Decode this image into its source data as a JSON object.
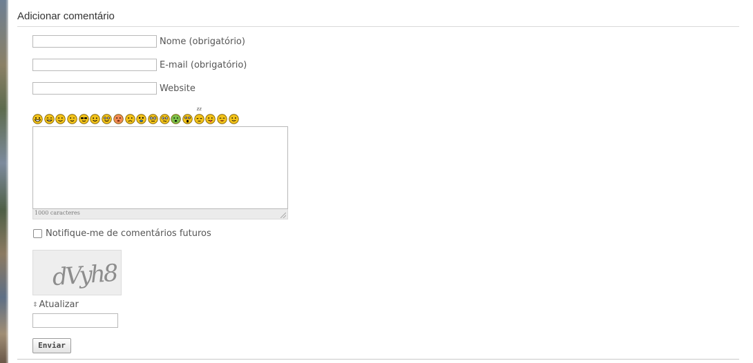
{
  "section": {
    "title": "Adicionar comentário"
  },
  "form": {
    "name": {
      "value": "",
      "label": "Nome (obrigatório)"
    },
    "email": {
      "value": "",
      "label": "E-mail (obrigatório)"
    },
    "website": {
      "value": "",
      "label": "Website"
    },
    "smileys": [
      "grin-smiley-icon",
      "big-smile-smiley-icon",
      "smile-smiley-icon",
      "wink-smiley-icon",
      "cool-smiley-icon",
      "happy-smiley-icon",
      "silly-smiley-icon",
      "blush-smiley-icon",
      "sad-smiley-icon",
      "surprised-smiley-icon",
      "glasses-smiley-icon",
      "confused-smiley-icon",
      "sick-smiley-icon",
      "shocked-smiley-icon",
      "sleepy-smiley-icon",
      "tongue-smiley-icon",
      "laugh-smiley-icon",
      "neutral-smiley-icon"
    ],
    "comment": {
      "value": "",
      "counter": "1000 caracteres"
    },
    "notify_label": "Notifique-me de comentários futuros",
    "notify_checked": false,
    "captcha": {
      "text": "dVyh8",
      "refresh_label": "Atualizar",
      "value": ""
    },
    "submit_label": "Enviar"
  },
  "colors": {
    "smiley_fill": "#f2c21a",
    "smiley_stroke": "#7a5c00",
    "blush_fill": "#f08a55",
    "sick_fill": "#7cc04a"
  }
}
